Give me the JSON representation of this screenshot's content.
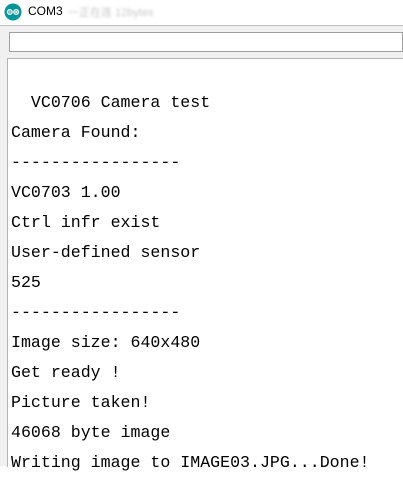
{
  "window": {
    "title": "COM3",
    "ghost_title": "一正在连 12bytes",
    "accent_color": "#00979c"
  },
  "send_input": {
    "value": ""
  },
  "serial_monitor": {
    "lines": [
      "  VC0706 Camera test",
      "Camera Found:",
      "-----------------",
      "VC0703 1.00",
      "Ctrl infr exist",
      "User-defined sensor",
      "525",
      "-----------------",
      "Image size: 640x480",
      "Get ready !",
      "Picture taken!",
      "46068 byte image",
      "Writing image to IMAGE03.JPG...Done!"
    ]
  }
}
